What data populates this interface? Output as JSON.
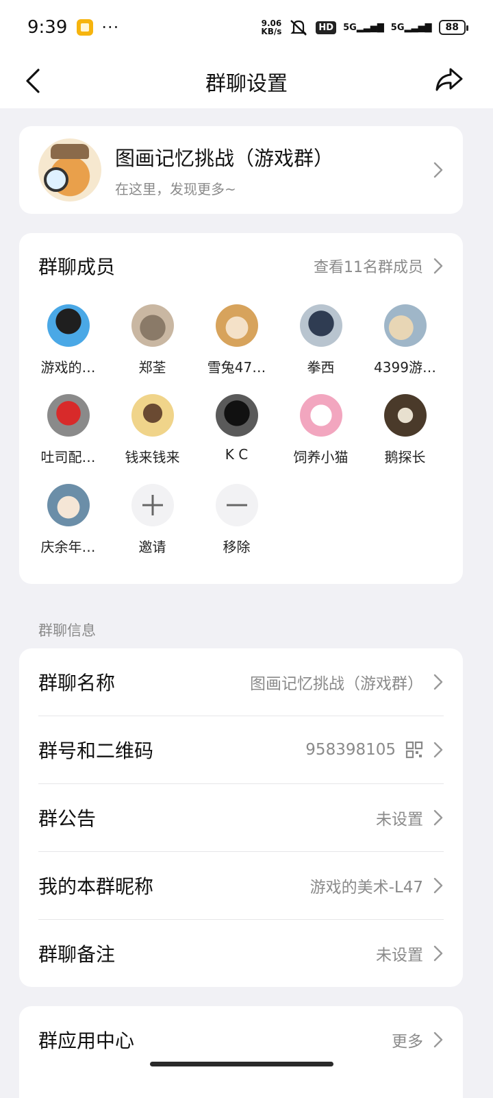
{
  "status_bar": {
    "time": "9:39",
    "net_speed": "9.06",
    "net_unit": "KB/s",
    "hd": "HD",
    "signal1": "5G",
    "signal2": "5G",
    "battery": "88"
  },
  "navbar": {
    "title": "群聊设置"
  },
  "group": {
    "name": "图画记忆挑战（游戏群）",
    "subtitle": "在这里，发现更多~"
  },
  "members": {
    "title": "群聊成员",
    "view_all": "查看11名群成员",
    "list": [
      {
        "name": "游戏的…"
      },
      {
        "name": "郑荃"
      },
      {
        "name": "雪兔47…"
      },
      {
        "name": "拳西"
      },
      {
        "name": "4399游…"
      },
      {
        "name": "吐司配…"
      },
      {
        "name": "钱来钱来"
      },
      {
        "name": "K C"
      },
      {
        "name": "饲养小猫"
      },
      {
        "name": "鹅探长"
      },
      {
        "name": "庆余年…"
      }
    ],
    "invite_label": "邀请",
    "remove_label": "移除"
  },
  "info_section": {
    "label": "群聊信息",
    "rows": [
      {
        "label": "群聊名称",
        "value": "图画记忆挑战（游戏群）"
      },
      {
        "label": "群号和二维码",
        "value": "958398105"
      },
      {
        "label": "群公告",
        "value": "未设置"
      },
      {
        "label": "我的本群昵称",
        "value": "游戏的美术-L47"
      },
      {
        "label": "群聊备注",
        "value": "未设置"
      }
    ]
  },
  "app_center": {
    "label": "群应用中心",
    "value": "更多"
  },
  "icons": {
    "back": "back-arrow-icon",
    "share": "share-icon",
    "chevron": "chevron-right-icon",
    "qr": "qr-code-icon",
    "plus": "plus-icon",
    "minus": "minus-icon"
  }
}
